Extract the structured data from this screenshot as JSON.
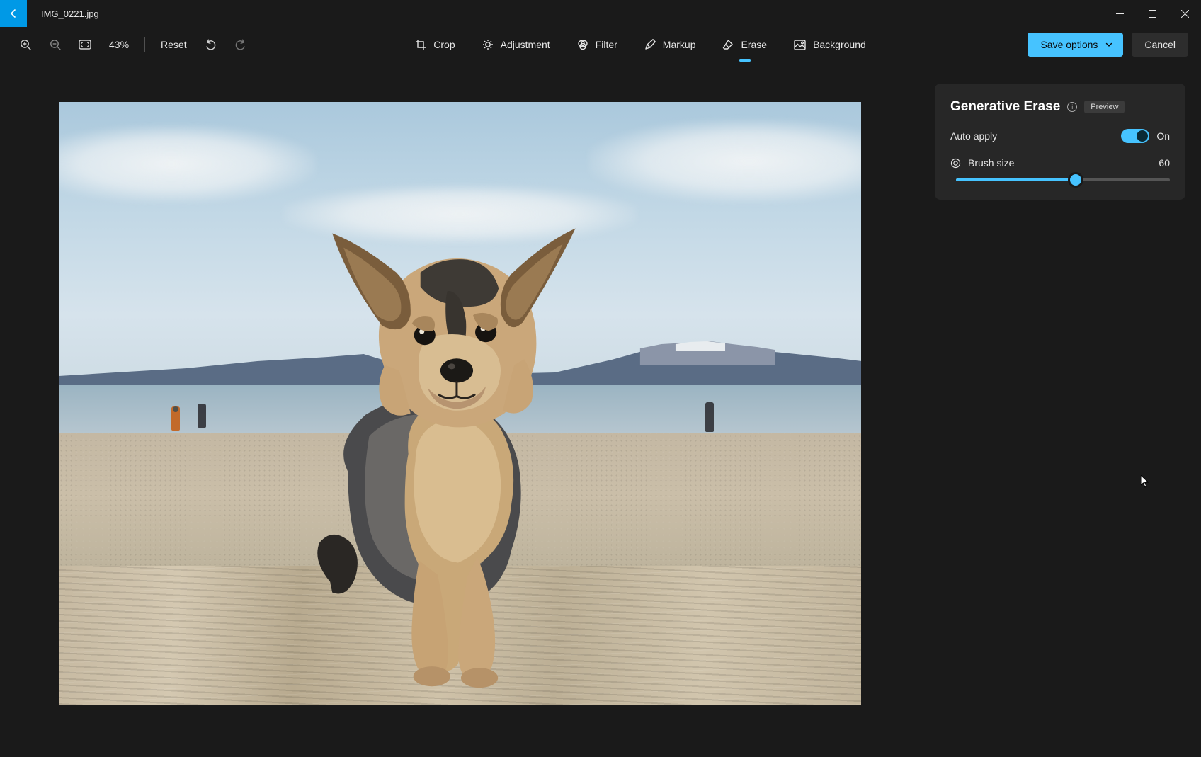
{
  "titlebar": {
    "filename": "IMG_0221.jpg"
  },
  "toolbar": {
    "zoom_pct": "43%",
    "reset": "Reset"
  },
  "tabs": {
    "crop": "Crop",
    "adjustment": "Adjustment",
    "filter": "Filter",
    "markup": "Markup",
    "erase": "Erase",
    "background": "Background",
    "active": "erase"
  },
  "actions": {
    "save": "Save options",
    "cancel": "Cancel"
  },
  "panel": {
    "title": "Generative Erase",
    "badge": "Preview",
    "auto_apply_label": "Auto apply",
    "auto_apply_state": "On",
    "brush_label": "Brush size",
    "brush_value": "60",
    "brush_pct": 56
  },
  "colors": {
    "accent": "#46c3ff",
    "back_btn": "#0099e6",
    "panel_bg": "#272727"
  }
}
